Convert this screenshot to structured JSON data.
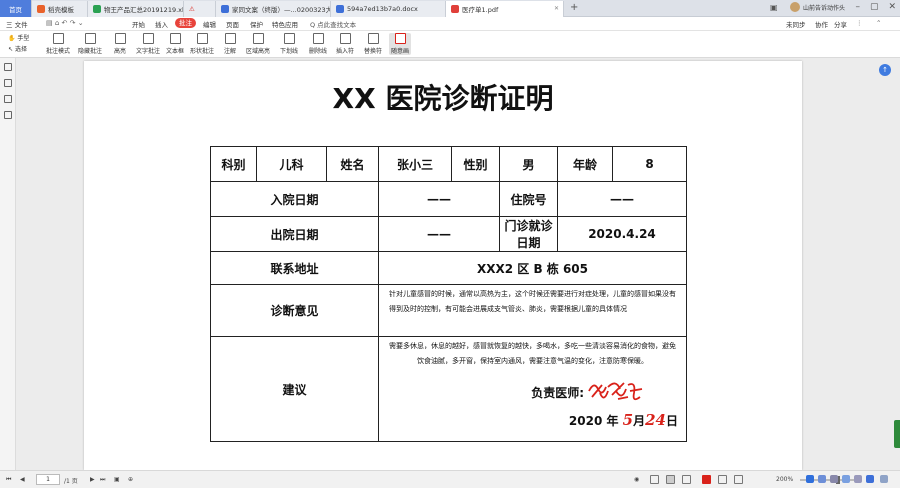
{
  "tabs": {
    "home": "首页",
    "t1": "稻壳模板",
    "t2": "物王产品汇总20191219.xls",
    "t3": "!",
    "t4": "家同文案（终版）—...0200323大赛",
    "t5": "594a7ed13b7a0.docx",
    "t6": "医疗单1.pdf"
  },
  "user": {
    "name": "山前告诉动作头"
  },
  "menu": {
    "file": "三 文件",
    "items": [
      "开始",
      "插入",
      "批注",
      "编辑",
      "页面",
      "保护",
      "特色应用"
    ],
    "active_index": 2,
    "search": "Q 点此查找文本",
    "right": [
      "未同步",
      "协作",
      "分享"
    ]
  },
  "lefttools": {
    "hand": "手型",
    "select": "选择"
  },
  "tools": [
    "批注模式",
    "隐藏批注",
    "高亮",
    "文字批注",
    "文本框",
    "形状批注",
    "注解",
    "区域高亮",
    "下划线",
    "删除线",
    "插入符",
    "替换符",
    "随意画"
  ],
  "document": {
    "title": "XX 医院诊断证明",
    "row1": [
      "科别",
      "儿科",
      "姓名",
      "张小三",
      "性别",
      "男",
      "年龄",
      "8"
    ],
    "row2": [
      "入院日期",
      "——",
      "住院号",
      "——"
    ],
    "row3": [
      "出院日期",
      "——",
      "门诊就诊日期",
      "2020.4.24"
    ],
    "row4": [
      "联系地址",
      "XXX2 区  B 栋  605"
    ],
    "row5_label": "诊断意见",
    "row5_text": "针对儿童感冒的时候，通常以高热为主，这个时候还需要进行对症处理，儿童的感冒如果没有得到及时的控制，有可能会进展成支气管炎、肺炎，需要根据儿童的具体情况",
    "row6_label": "建议",
    "row6_text": "需要多休息，休息的越好，感冒就恢复的越快，多喝水，多吃一些清淡容易消化的食物，避免饮食油腻，多开窗，保持室内通风，需要注意气温的变化，注意防寒保暖。",
    "doctor_label": "负责医师:",
    "date_year": "2020 年",
    "date_month": "5",
    "date_month_unit": "月",
    "date_day": "24",
    "date_day_unit": "日"
  },
  "status": {
    "page_current": "1",
    "page_total": "/1 页",
    "zoom": "200%"
  },
  "colors": {
    "accent": "#4f7ddc",
    "annotation_red": "#d9221a",
    "menu_active": "#e8433b"
  }
}
